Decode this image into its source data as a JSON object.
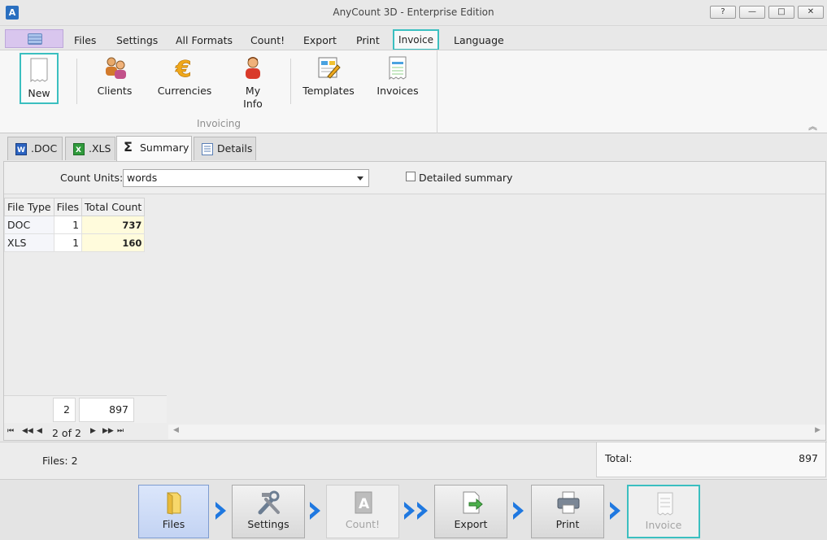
{
  "window": {
    "title": "AnyCount 3D - Enterprise Edition",
    "app_icon_letter": "A",
    "buttons": {
      "help": "?",
      "minimize": "—",
      "maximize": "□",
      "close": "✕"
    }
  },
  "menu": {
    "tabs": [
      "Files",
      "Settings",
      "All Formats",
      "Count!",
      "Export",
      "Print",
      "Invoice",
      "Language"
    ],
    "active": "Invoice"
  },
  "ribbon": {
    "buttons": {
      "new": "New",
      "clients": "Clients",
      "currencies": "Currencies",
      "my_info_1": "My",
      "my_info_2": "Info",
      "templates": "Templates",
      "invoices": "Invoices"
    },
    "group_label": "Invoicing"
  },
  "doc_tabs": {
    "doc": ".DOC",
    "xls": ".XLS",
    "summary": "Summary",
    "details": "Details",
    "active": "Summary"
  },
  "summary": {
    "count_units_label": "Count Units:",
    "count_units_value": "words",
    "detailed_summary_label": "Detailed summary",
    "detailed_summary_checked": false
  },
  "grid": {
    "headers": [
      "File Type",
      "Files",
      "Total Count"
    ],
    "rows": [
      {
        "type": "DOC",
        "files": "1",
        "count": "737"
      },
      {
        "type": "XLS",
        "files": "1",
        "count": "160"
      }
    ],
    "footer_files": "2",
    "footer_count": "897",
    "pager_text": "2 of 2"
  },
  "status": {
    "files_label": "Files:",
    "files_value": "2",
    "total_label": "Total:",
    "total_value": "897"
  },
  "workflow": {
    "files": "Files",
    "settings": "Settings",
    "count": "Count!",
    "export": "Export",
    "print": "Print",
    "invoice": "Invoice"
  },
  "colors": {
    "highlight": "#3bbfc0",
    "chevron": "#1f78e0",
    "total_cell": "#fffbdc"
  }
}
